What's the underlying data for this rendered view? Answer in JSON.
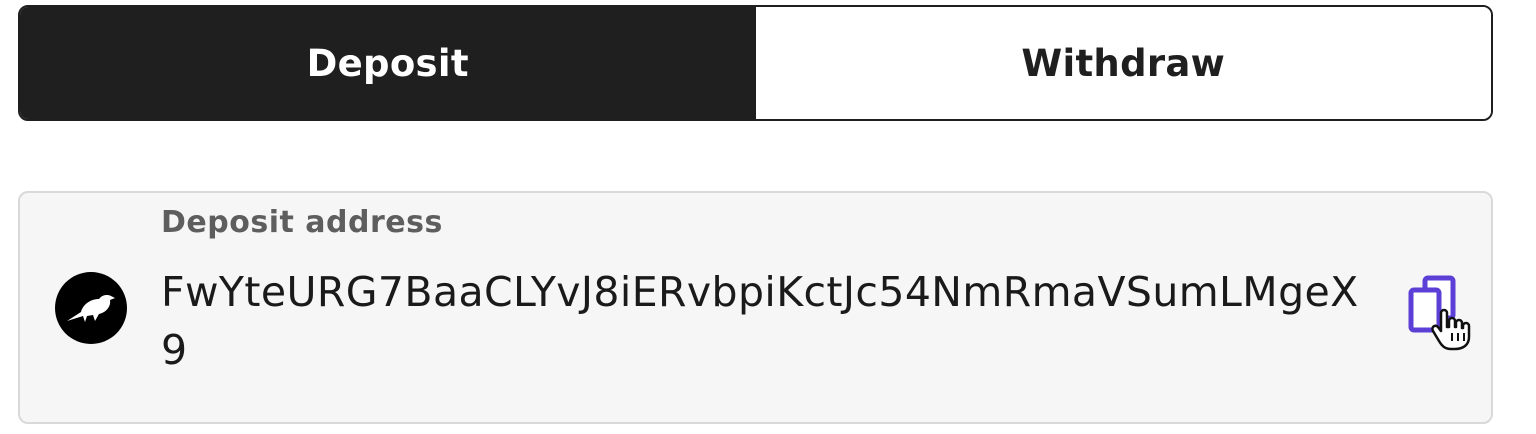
{
  "tabs": [
    {
      "label": "Deposit",
      "active": true
    },
    {
      "label": "Withdraw",
      "active": false
    }
  ],
  "deposit": {
    "label": "Deposit address",
    "address": "FwYteURG7BaaCLYvJ8iERvbpiKctJc54NmRmaVSumLMgeX9",
    "token_icon": "bird-icon",
    "copy_icon": "copy-icon"
  },
  "colors": {
    "active_tab_bg": "#1f1f1f",
    "copy_icon": "#5b3fd6"
  }
}
